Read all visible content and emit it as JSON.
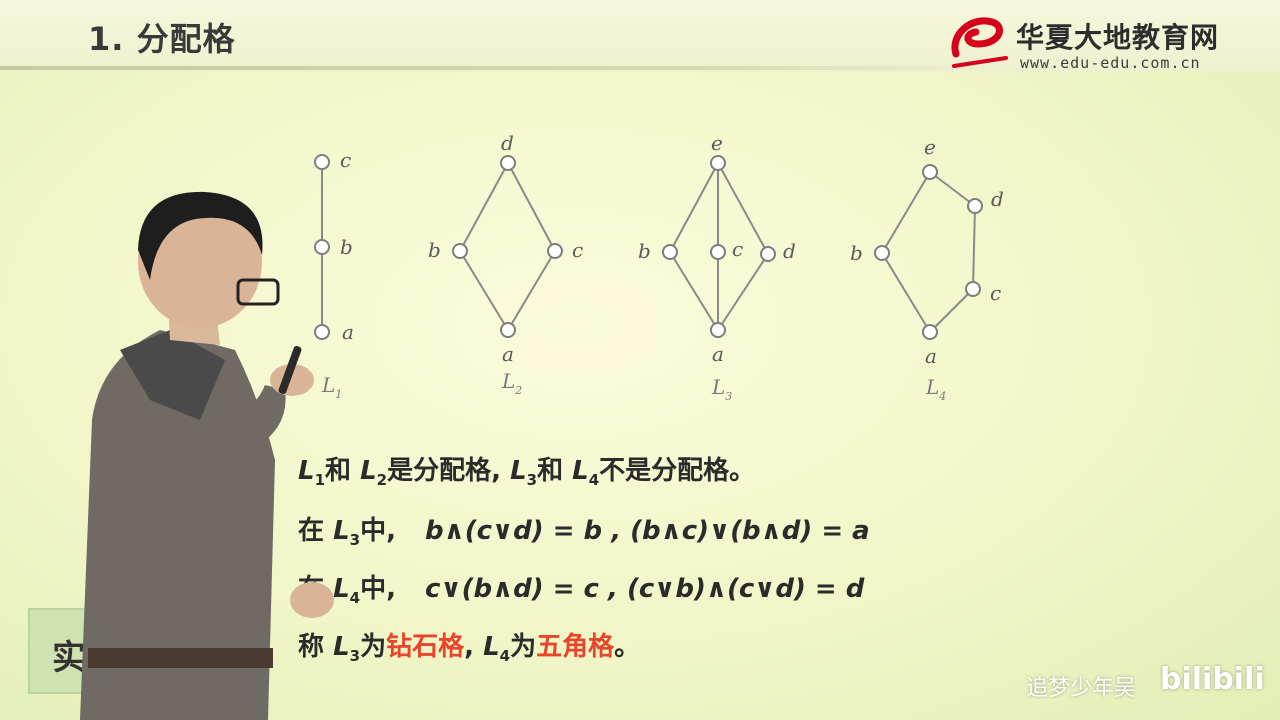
{
  "header": {
    "title": "1. 分配格"
  },
  "logo": {
    "name": "华夏大地教育网",
    "url": "www.edu-edu.com.cn"
  },
  "lattices": [
    {
      "name": "L",
      "sub": "1",
      "labels": [
        "c",
        "b",
        "a"
      ]
    },
    {
      "name": "L",
      "sub": "2",
      "labels": [
        "d",
        "b",
        "c",
        "a"
      ]
    },
    {
      "name": "L",
      "sub": "3",
      "labels": [
        "e",
        "b",
        "c",
        "d",
        "a"
      ]
    },
    {
      "name": "L",
      "sub": "4",
      "labels": [
        "e",
        "d",
        "b",
        "c",
        "a"
      ]
    }
  ],
  "lines": {
    "line1": {
      "L1": "L",
      "s1": "1",
      "and1": "和",
      "L2": "L",
      "s2": "2",
      "is": "是分配格,",
      "L3": "L",
      "s3": "3",
      "and2": "和",
      "L4": "L",
      "s4": "4",
      "not": "不是分配格。"
    },
    "line2": {
      "pre": "在",
      "L": "L",
      "s": "3",
      "mid": "中,",
      "formula": "b∧(c∨d) = b , (b∧c)∨(b∧d) = a"
    },
    "line3": {
      "pre": "在",
      "L": "L",
      "s": "4",
      "mid": "中,",
      "formula": "c∨(b∧d) = c , (c∨b)∧(c∨d) = d"
    },
    "line4": {
      "pre": "称",
      "L1": "L",
      "s1": "3",
      "w1": "为",
      "diamond": "钻石格",
      "comma": ",",
      "L2": "L",
      "s2": "4",
      "w2": "为",
      "pentagon": "五角格",
      "end": "。"
    }
  },
  "side_badge": "实",
  "watermark": {
    "user": "追梦少年吴",
    "site": "bilibili"
  },
  "colors": {
    "accent": "#e8452a",
    "logo_red": "#d6001c",
    "node_fill": "#ffffff",
    "edge": "#8a8a8a"
  }
}
